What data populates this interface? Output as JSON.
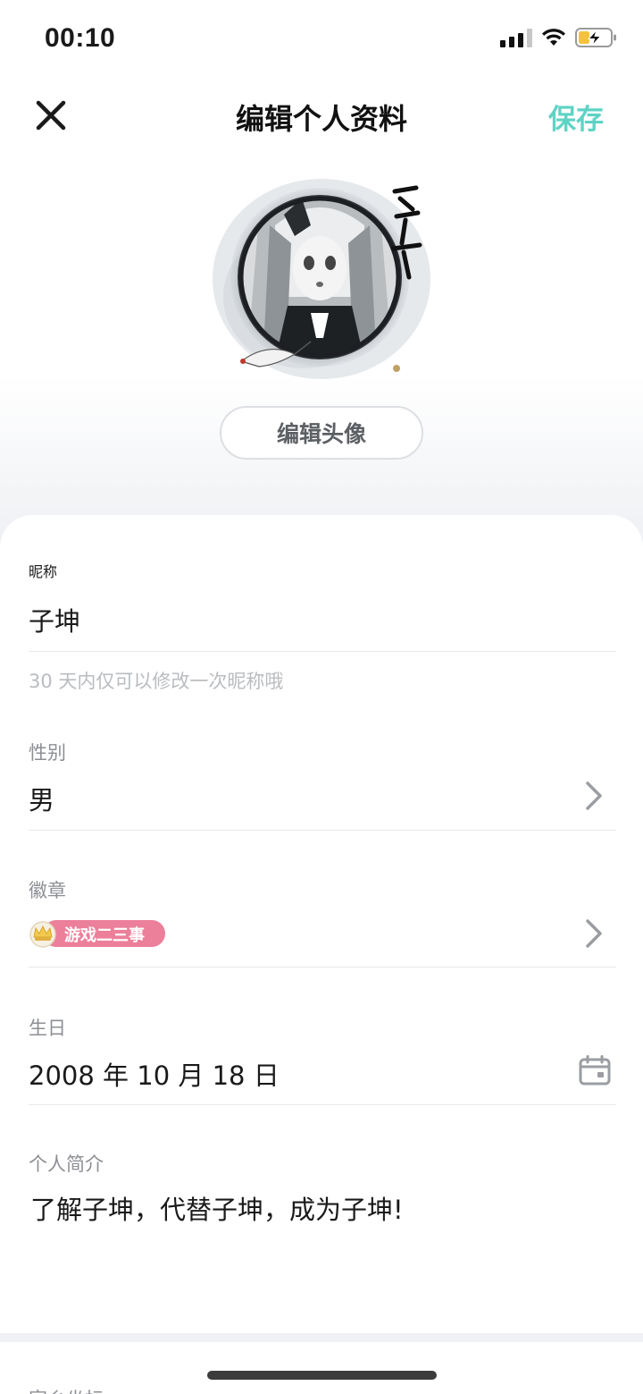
{
  "status_bar": {
    "time": "00:10",
    "icons": [
      "signal-icon",
      "wifi-icon",
      "battery-charging-icon"
    ]
  },
  "nav": {
    "title": "编辑个人资料",
    "save_label": "保存",
    "close_icon": "close-icon"
  },
  "avatar": {
    "edit_label": "编辑头像"
  },
  "form": {
    "nickname": {
      "label": "昵称",
      "value": "子坤",
      "hint": "30 天内仅可以修改一次昵称哦"
    },
    "gender": {
      "label": "性别",
      "value": "男"
    },
    "badge": {
      "label": "徽章",
      "badge_text": "游戏二三事"
    },
    "birthday": {
      "label": "生日",
      "value": "2008 年 10 月 18 日"
    },
    "bio": {
      "label": "个人简介",
      "value": "了解子坤，代替子坤，成为子坤!"
    }
  },
  "bottom_section": {
    "label": "家乡坐标"
  },
  "colors": {
    "accent": "#5ed3c5",
    "badge_pink": "#ec7f9a",
    "label_gray": "#8c8f94",
    "hint_gray": "#b9bcc0"
  }
}
